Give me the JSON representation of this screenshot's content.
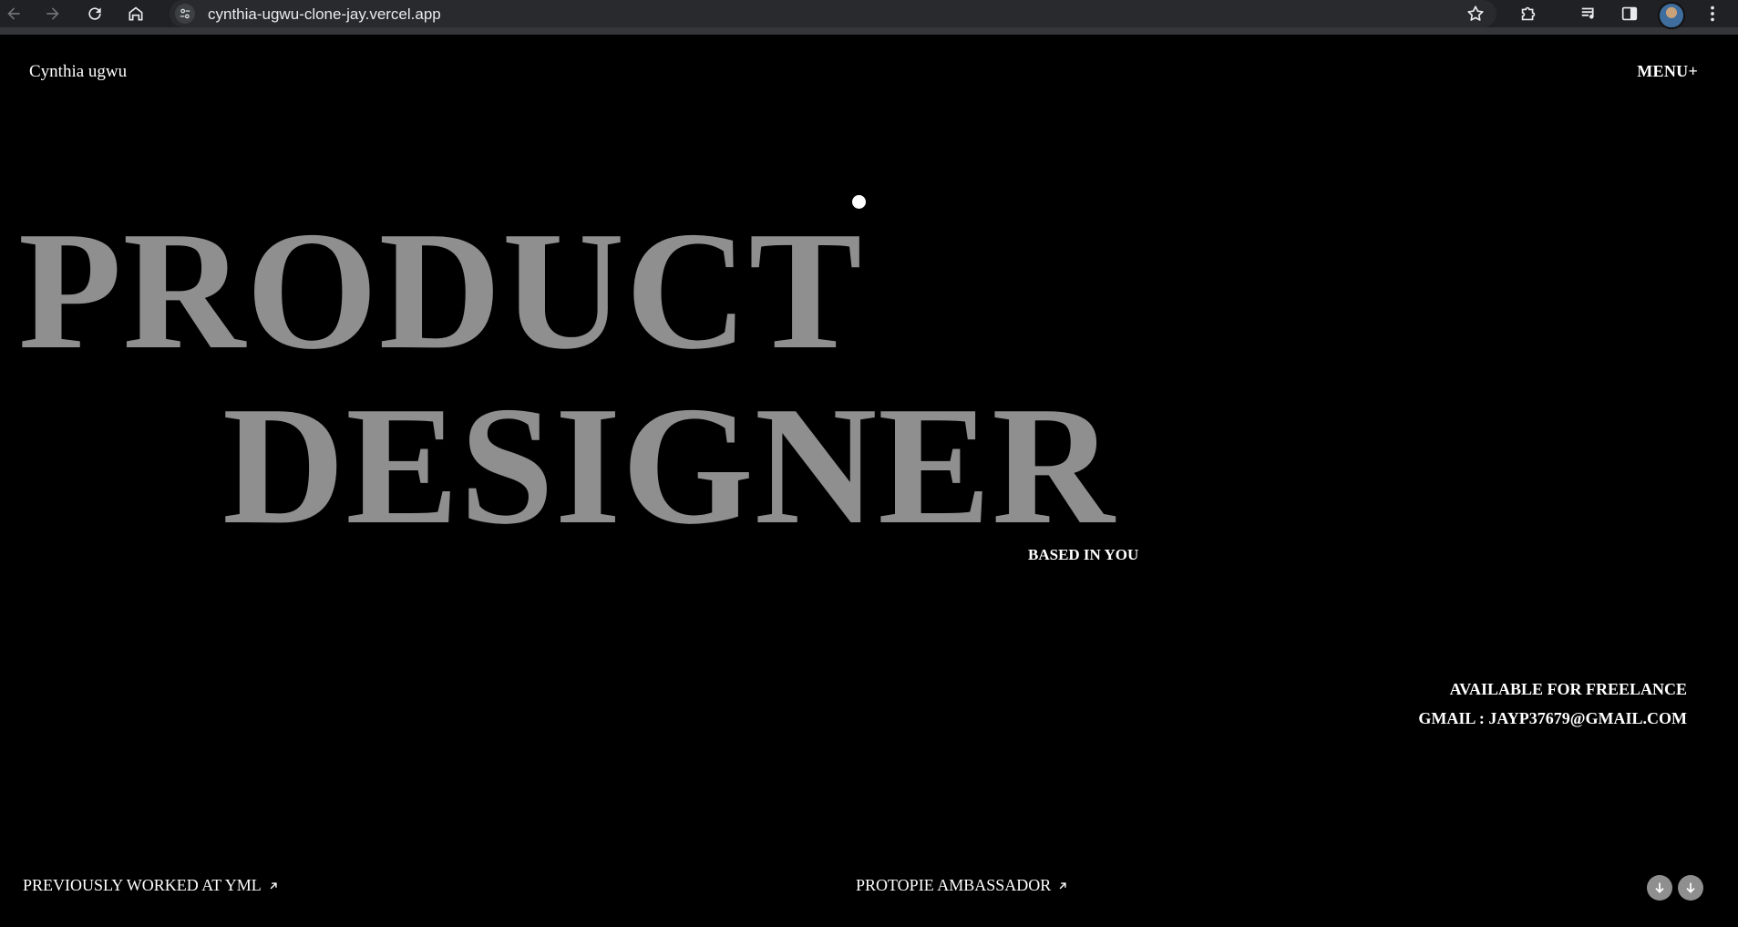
{
  "browser": {
    "url": "cynthia-ugwu-clone-jay.vercel.app",
    "icons": [
      "back-arrow-icon",
      "forward-arrow-icon",
      "reload-icon",
      "home-icon",
      "site-settings-icon",
      "bookmark-star-icon",
      "extensions-icon",
      "media-controls-icon",
      "side-panel-icon",
      "profile-avatar",
      "more-menu-icon"
    ]
  },
  "header": {
    "brand": "Cynthia ugwu",
    "menu_label": "MENU+"
  },
  "hero": {
    "line1": "PRODUCT",
    "line2": "DESIGNER",
    "sub": "BASED IN YOU"
  },
  "contact": {
    "availability": "AVAILABLE FOR FREELANCE",
    "email": "GMAIL : JAYP37679@GMAIL.COM"
  },
  "footer": {
    "left_link": "PREVIOUSLY WORKED AT YML",
    "mid_link": "PROTOPIE AMBASSADOR"
  },
  "colors": {
    "background": "#000000",
    "hero_text": "#8f8f8f",
    "text": "#ffffff"
  }
}
